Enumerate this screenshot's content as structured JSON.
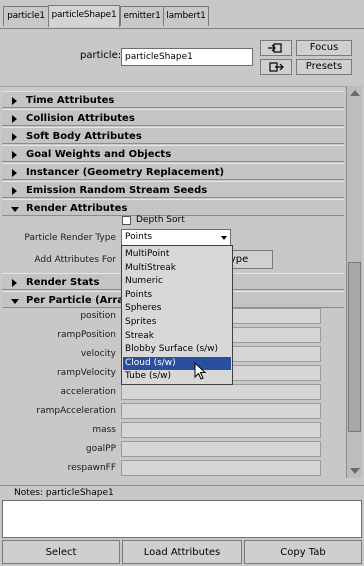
{
  "tabs": [
    "particle1",
    "particleShape1",
    "emitter1",
    "lambert1"
  ],
  "header": {
    "node_label": "particle:",
    "node_value": "particleShape1",
    "focus_label": "Focus",
    "presets_label": "Presets"
  },
  "sections": {
    "time": "Time Attributes",
    "collision": "Collision Attributes",
    "softbody": "Soft Body Attributes",
    "goal": "Goal Weights and Objects",
    "instancer": "Instancer (Geometry Replacement)",
    "emission": "Emission Random Stream Seeds",
    "render": "Render Attributes",
    "renderstats": "Render Stats",
    "perparticle": "Per Particle (Array) Attributes"
  },
  "render": {
    "depth_sort": "Depth Sort",
    "render_type_label": "Particle Render Type",
    "render_type_value": "Points",
    "add_attrs_label": "Add Attributes For",
    "current_render_type_btn": "Current Render Type"
  },
  "dropdown_options": [
    "MultiPoint",
    "MultiStreak",
    "Numeric",
    "Points",
    "Spheres",
    "Sprites",
    "Streak",
    "Blobby Surface (s/w)",
    "Cloud (s/w)",
    "Tube (s/w)"
  ],
  "per_particle": [
    "position",
    "rampPosition",
    "velocity",
    "rampVelocity",
    "acceleration",
    "rampAcceleration",
    "mass",
    "goalPP",
    "respawnFF"
  ],
  "notes_label": "Notes:  particleShape1",
  "bottom": {
    "select": "Select",
    "load": "Load Attributes",
    "copy": "Copy Tab"
  },
  "colors": {
    "selection": "#2a4ea0",
    "panel": "#c8c8c8"
  }
}
